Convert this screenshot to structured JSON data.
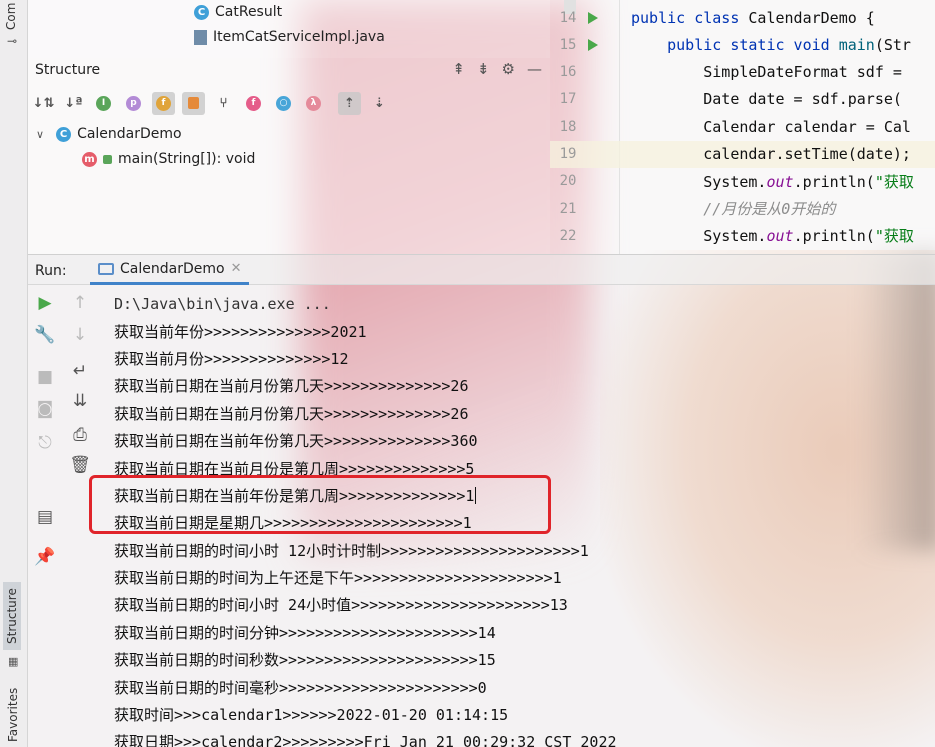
{
  "left_strip": {
    "top_label": "Com",
    "structure_label": "Structure",
    "favorites_label": "Favorites"
  },
  "tree": {
    "items": [
      "CatResult",
      "ItemCatServiceImpl.java"
    ]
  },
  "structure": {
    "title": "Structure",
    "root": "CalendarDemo",
    "method": "main(String[]): void"
  },
  "editor": {
    "lines": [
      {
        "num": "14",
        "run": true,
        "parts": [
          {
            "t": "public class ",
            "c": "kw"
          },
          {
            "t": "CalendarDemo {",
            "c": ""
          }
        ]
      },
      {
        "num": "15",
        "run": true,
        "parts": [
          {
            "t": "    public static void ",
            "c": "kw"
          },
          {
            "t": "main",
            "c": "fn"
          },
          {
            "t": "(Str",
            "c": ""
          }
        ]
      },
      {
        "num": "16",
        "run": false,
        "parts": [
          {
            "t": "        SimpleDateFormat sdf = ",
            "c": ""
          }
        ]
      },
      {
        "num": "17",
        "run": false,
        "parts": [
          {
            "t": "        Date date = sdf.parse(",
            "c": ""
          }
        ]
      },
      {
        "num": "18",
        "run": false,
        "parts": [
          {
            "t": "        Calendar calendar = Cal",
            "c": ""
          }
        ]
      },
      {
        "num": "19",
        "run": false,
        "current": true,
        "parts": [
          {
            "t": "        calendar.setTime(date);",
            "c": ""
          }
        ]
      },
      {
        "num": "20",
        "run": false,
        "parts": [
          {
            "t": "        System.",
            "c": ""
          },
          {
            "t": "out",
            "c": "it"
          },
          {
            "t": ".println(",
            "c": ""
          },
          {
            "t": "\"获取",
            "c": "str"
          }
        ]
      },
      {
        "num": "21",
        "run": false,
        "parts": [
          {
            "t": "        //月份是从0开始的",
            "c": "cm"
          }
        ]
      },
      {
        "num": "22",
        "run": false,
        "parts": [
          {
            "t": "        System.",
            "c": ""
          },
          {
            "t": "out",
            "c": "it"
          },
          {
            "t": ".println(",
            "c": ""
          },
          {
            "t": "\"获取",
            "c": "str"
          }
        ]
      }
    ]
  },
  "run": {
    "label": "Run:",
    "tab": "CalendarDemo",
    "console": [
      "D:\\Java\\bin\\java.exe ...",
      "获取当前年份>>>>>>>>>>>>>>2021",
      "获取当前月份>>>>>>>>>>>>>>12",
      "获取当前日期在当前月份第几天>>>>>>>>>>>>>>26",
      "获取当前日期在当前月份第几天>>>>>>>>>>>>>>26",
      "获取当前日期在当前年份第几天>>>>>>>>>>>>>>360",
      "获取当前日期在当前月份是第几周>>>>>>>>>>>>>>5",
      "获取当前日期在当前年份是第几周>>>>>>>>>>>>>>1",
      "获取当前日期是星期几>>>>>>>>>>>>>>>>>>>>>>1",
      "获取当前日期的时间小时 12小时计时制>>>>>>>>>>>>>>>>>>>>>>1",
      "获取当前日期的时间为上午还是下午>>>>>>>>>>>>>>>>>>>>>>1",
      "获取当前日期的时间小时 24小时值>>>>>>>>>>>>>>>>>>>>>>13",
      "获取当前日期的时间分钟>>>>>>>>>>>>>>>>>>>>>>14",
      "获取当前日期的时间秒数>>>>>>>>>>>>>>>>>>>>>>15",
      "获取当前日期的时间毫秒>>>>>>>>>>>>>>>>>>>>>>0",
      "获取时间>>>calendar1>>>>>>2022-01-20 01:14:15",
      "获取日期>>>calendar2>>>>>>>>>Fri Jan 21 00:29:32 CST 2022"
    ]
  },
  "colors": {
    "accent": "#4083c9",
    "highlight": "#e0242a",
    "run_green": "#4aa84a"
  }
}
